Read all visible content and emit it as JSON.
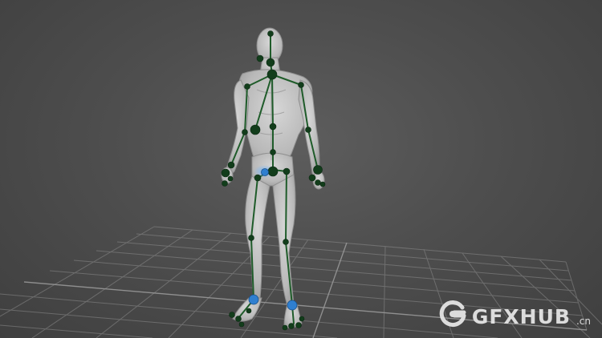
{
  "viewport": {
    "background_color": "#4e4e4e",
    "grid_color": "#8c8c8c",
    "mannequin_color": "#c9c9c9",
    "bone_color": "#1f5c2a",
    "joint_color": "#123d1b",
    "selected_joint_color": "#2f7fd0",
    "joint_count": 35,
    "selected_joints": [
      "pelvis",
      "left-foot",
      "right-foot"
    ]
  },
  "watermark": {
    "icon": "gfxhub-g-logo-icon",
    "brand": "GFXHUB",
    "domain": ".cn"
  }
}
